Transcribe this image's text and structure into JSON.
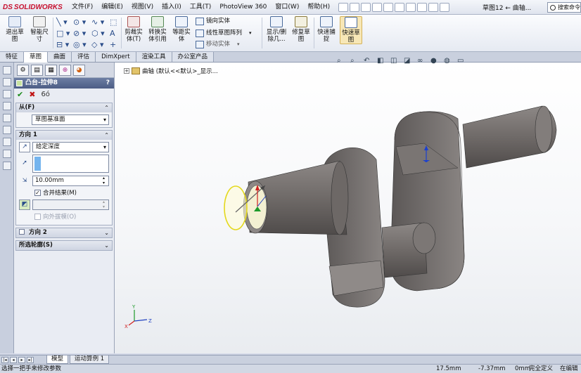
{
  "app": {
    "brand_ds": "DS",
    "brand_name": "SOLIDWORKS"
  },
  "menu": [
    "文件(F)",
    "编辑(E)",
    "视图(V)",
    "插入(I)",
    "工具(T)",
    "PhotoView 360",
    "窗口(W)",
    "帮助(H)"
  ],
  "document_title": "草图12 ← 曲轴...",
  "search_placeholder": "搜索命令",
  "ribbon": {
    "exit_sketch": "退出草\n图",
    "smart_dimension": "智能尺\n寸",
    "trim_entities": "剪裁实\n体(T)",
    "convert_entities": "转换实\n体引用",
    "offset_entities": "等距实\n体",
    "mirror_entities": "镜向实体",
    "linear_pattern": "线性草图阵列",
    "move_entities": "移动实体",
    "display_delete": "显示/删\n除几...",
    "repair_sketch": "修复草\n图",
    "quick_snaps": "快速捕\n捉",
    "rapid_sketch": "快速草\n图"
  },
  "tabs": [
    "特征",
    "草图",
    "曲面",
    "评估",
    "DimXpert",
    "渲染工具",
    "办公室产品"
  ],
  "active_tab": "草图",
  "property_manager": {
    "title": "凸台-拉伸8",
    "help": "?",
    "from": {
      "header": "从(F)",
      "value": "草图基准面"
    },
    "direction1": {
      "header": "方向 1",
      "end_condition": "给定深度",
      "depth": "10.00mm",
      "merge_label": "合并结果(M)",
      "merge_checked": true,
      "draft_label": "向外拔模(O)",
      "draft_checked": false
    },
    "direction2": {
      "header": "方向 2"
    },
    "selected_contours": {
      "header": "所选轮廓(S)"
    }
  },
  "feature_tree": {
    "item": "曲轴  (默认<<默认>_显示..."
  },
  "bottom_tabs": [
    "模型",
    "运动算例 1"
  ],
  "status": {
    "message": "选择一把手来修改参数",
    "x": "17.5mm",
    "y": "-7.37mm",
    "z": "0mm",
    "state": "完全定义",
    "mode": "在编辑"
  },
  "colors": {
    "model": "#7f7a78",
    "accent": "#c8102e",
    "titlebar": "#4c5d85"
  }
}
